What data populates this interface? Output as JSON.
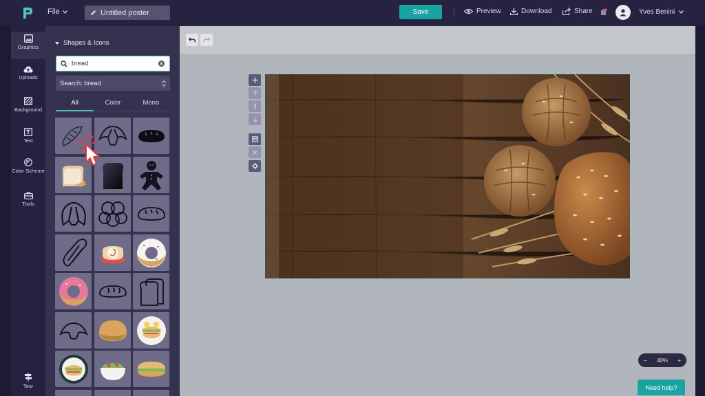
{
  "header": {
    "file_label": "File",
    "title": "Untitled poster",
    "save_label": "Save",
    "preview_label": "Preview",
    "download_label": "Download",
    "share_label": "Share",
    "user_name": "Yves Benini"
  },
  "nav": {
    "items": [
      {
        "label": "Graphics"
      },
      {
        "label": "Uploads"
      },
      {
        "label": "Background"
      },
      {
        "label": "Text"
      },
      {
        "label": "Color Scheme"
      },
      {
        "label": "Tools"
      }
    ],
    "tour_label": "Tour"
  },
  "panel": {
    "heading": "Shapes & Icons",
    "search_value": "bread",
    "search_select": "Search: bread",
    "tabs": [
      "All",
      "Color",
      "Mono"
    ],
    "active_tab": "All"
  },
  "workspace": {
    "zoom_level": "40%",
    "zoom_minus": "−",
    "zoom_plus": "+",
    "help_label": "Need help?"
  },
  "colors": {
    "accent": "#1aa3a3",
    "topbar": "#252340",
    "panel": "#34324f",
    "workspace": "#b1b6bd"
  }
}
